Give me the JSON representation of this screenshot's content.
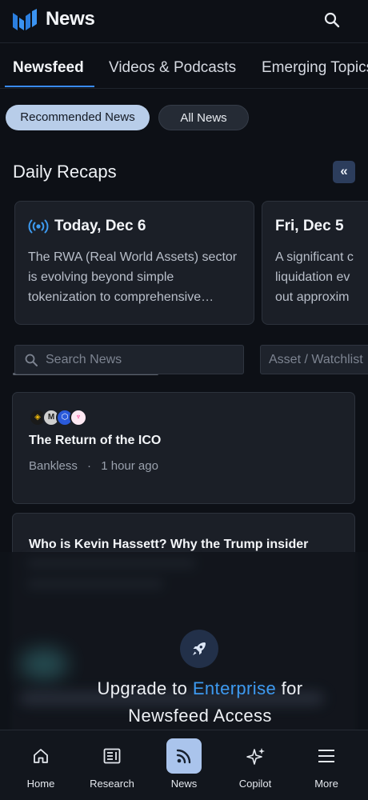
{
  "app": {
    "title": "News",
    "logo_icon": "brand-logo",
    "search_icon": "search-icon"
  },
  "tabs": [
    {
      "label": "Newsfeed",
      "active": true
    },
    {
      "label": "Videos & Podcasts",
      "active": false
    },
    {
      "label": "Emerging Topics",
      "active": false
    }
  ],
  "filters": {
    "recommended": "Recommended News",
    "all": "All News"
  },
  "daily_recaps": {
    "title": "Daily Recaps",
    "collapse_label": "«",
    "cards": [
      {
        "date": "Today, Dec 6",
        "live": true,
        "summary": "The RWA (Real World Assets) sector\nis evolving beyond simple\ntokenization to comprehensive…"
      },
      {
        "date": "Fri, Dec 5",
        "live": false,
        "summary": "A significant c\nliquidation ev\nout approxim"
      }
    ]
  },
  "search": {
    "placeholder": "Search News",
    "asset_placeholder": "Asset / Watchlist"
  },
  "news": [
    {
      "title": "The Return of the ICO",
      "source": "Bankless",
      "separator": "·",
      "time": "1 hour ago",
      "tokens": [
        "bnb-icon",
        "m-token-icon",
        "chainlink-icon",
        "uniswap-icon"
      ]
    },
    {
      "title": "Who is Kevin Hassett? Why the Trump insider"
    }
  ],
  "paywall": {
    "pre": "Upgrade to ",
    "accent": "Enterprise",
    "post": " for",
    "line2": "Newsfeed Access",
    "icon": "rocket-icon",
    "accent_color": "#3d9af0"
  },
  "bottom_nav": [
    {
      "label": "Home",
      "icon": "home-icon",
      "active": false
    },
    {
      "label": "Research",
      "icon": "research-icon",
      "active": false
    },
    {
      "label": "News",
      "icon": "rss-icon",
      "active": true
    },
    {
      "label": "Copilot",
      "icon": "sparkle-icon",
      "active": false
    },
    {
      "label": "More",
      "icon": "menu-icon",
      "active": false
    }
  ]
}
